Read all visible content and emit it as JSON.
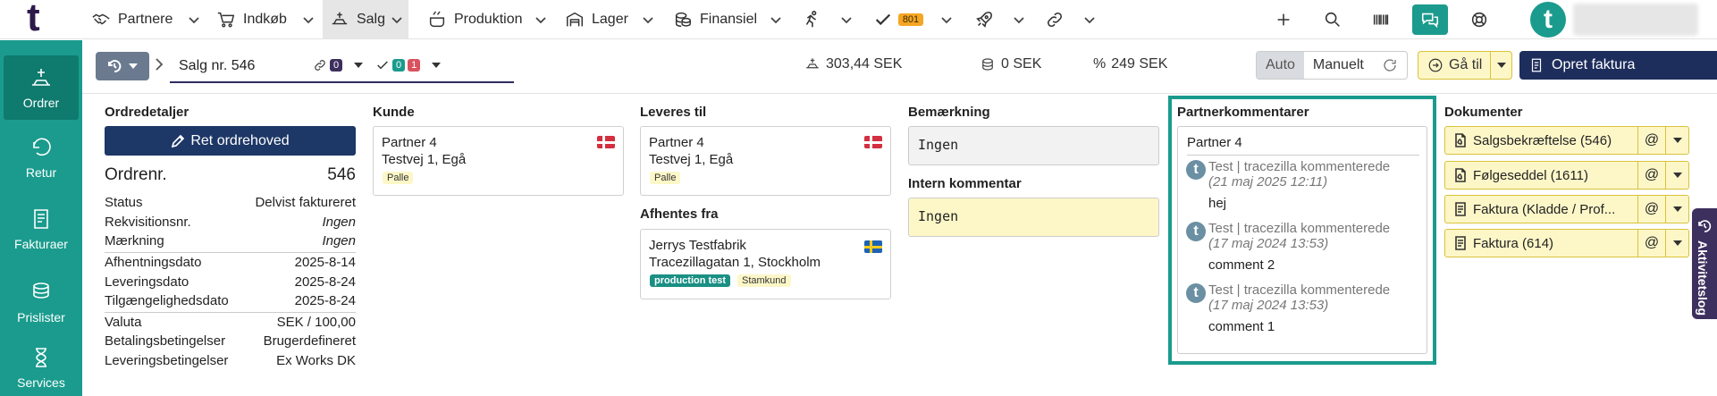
{
  "topnav": {
    "logo": "t",
    "items": [
      {
        "label": "Partnere",
        "icon": "handshake-icon"
      },
      {
        "label": "Indkøb",
        "icon": "cart-icon"
      },
      {
        "label": "Salg",
        "icon": "sales-icon"
      },
      {
        "label": "Produktion",
        "icon": "pot-icon"
      },
      {
        "label": "Lager",
        "icon": "warehouse-icon"
      },
      {
        "label": "Finansiel",
        "icon": "coins-icon"
      }
    ],
    "task_badge": "801",
    "avatar_letter": "t"
  },
  "sidebar": {
    "items": [
      {
        "label": "Ordrer"
      },
      {
        "label": "Retur"
      },
      {
        "label": "Fakturaer"
      },
      {
        "label": "Prislister"
      },
      {
        "label": "Services"
      }
    ]
  },
  "toolbar": {
    "title": "Salg nr. 546",
    "link_count": "0",
    "check_green": "0",
    "check_red": "1",
    "stat1": "303,44 SEK",
    "stat2": "0 SEK",
    "stat3": "249 SEK",
    "mode_auto": "Auto",
    "mode_manual": "Manuelt",
    "goto": "Gå til",
    "create_invoice": "Opret faktura",
    "more": "⋮"
  },
  "order": {
    "title": "Ordredetaljer",
    "button": "Ret ordrehoved",
    "nr_label": "Ordrenr.",
    "nr_value": "546",
    "status_label": "Status",
    "status_value": "Delvist faktureret",
    "rek_label": "Rekvisitionsnr.",
    "rek_value": "Ingen",
    "mark_label": "Mærkning",
    "mark_value": "Ingen",
    "pickup_label": "Afhentningsdato",
    "pickup_value": "2025-8-14",
    "delivery_label": "Leveringsdato",
    "delivery_value": "2025-8-24",
    "avail_label": "Tilgængelighedsdato",
    "avail_value": "2025-8-24",
    "currency_label": "Valuta",
    "currency_value": "SEK / 100,00",
    "payterms_label": "Betalingsbetingelser",
    "payterms_value": "Brugerdefineret",
    "delterms_label": "Leveringsbetingelser",
    "delterms_value": "Ex Works DK"
  },
  "customer": {
    "title": "Kunde",
    "name": "Partner 4",
    "address": "Testvej 1, Egå",
    "tag": "Palle"
  },
  "delivery": {
    "title": "Leveres til",
    "name": "Partner 4",
    "address": "Testvej 1, Egå",
    "tag": "Palle"
  },
  "pickup": {
    "title": "Afhentes fra",
    "name": "Jerrys Testfabrik",
    "address": "Tracezillagatan 1, Stockholm",
    "tag1": "production test",
    "tag2": "Stamkund"
  },
  "notes": {
    "title": "Bemærkning",
    "value": "Ingen",
    "internal_title": "Intern kommentar",
    "internal_value": "Ingen"
  },
  "partner_comments": {
    "title": "Partnerkommentarer",
    "partner": "Partner 4",
    "comments": [
      {
        "meta": "Test | tracezilla kommenterede",
        "date": "(21 maj 2025 12:11)",
        "text": "hej"
      },
      {
        "meta": "Test | tracezilla kommenterede",
        "date": "(17 maj 2024 13:53)",
        "text": "comment 2"
      },
      {
        "meta": "Test | tracezilla kommenterede",
        "date": "(17 maj 2024 13:53)",
        "text": "comment 1"
      }
    ]
  },
  "documents": {
    "title": "Dokumenter",
    "items": [
      {
        "label": "Salgsbekræftelse (546)"
      },
      {
        "label": "Følgeseddel (1611)"
      },
      {
        "label": "Faktura (Kladde / Prof..."
      },
      {
        "label": "Faktura (614)"
      }
    ],
    "at": "@"
  },
  "activity": {
    "label": "Aktivitetslog"
  },
  "colors": {
    "teal": "#1a9b8d",
    "navy": "#1d2d5c",
    "purple": "#5d2d6d",
    "yellow": "#fdf7c8"
  }
}
